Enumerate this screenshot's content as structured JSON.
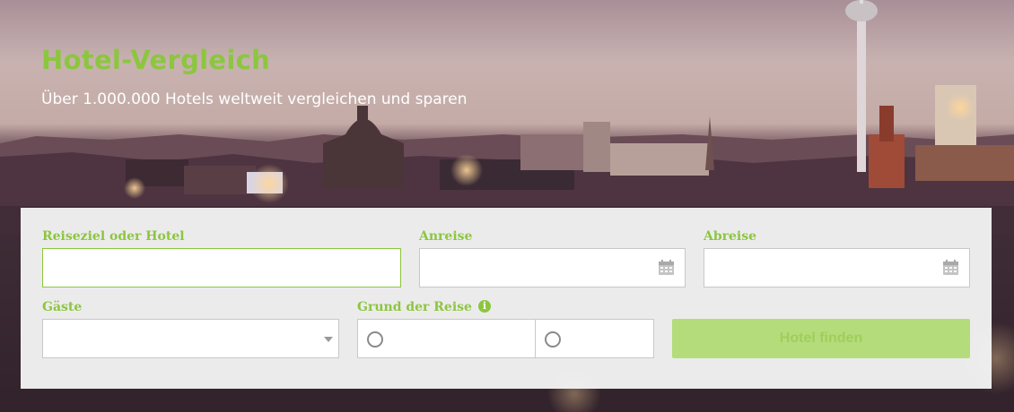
{
  "hero": {
    "title": "Hotel-Vergleich",
    "subtitle": "Über 1.000.000 Hotels weltweit vergleichen und sparen"
  },
  "form": {
    "destination_label": "Reiseziel oder Hotel",
    "destination_value": "",
    "checkin_label": "Anreise",
    "checkin_value": "",
    "checkout_label": "Abreise",
    "checkout_value": "",
    "guests_label": "Gäste",
    "guests_value": "",
    "reason_label": "Grund der Reise",
    "reason_options": [
      "",
      ""
    ],
    "submit_label": "Hotel finden"
  },
  "icons": {
    "calendar": "calendar-icon",
    "info": "info-icon",
    "dropdown": "chevron-down-icon"
  },
  "colors": {
    "accent": "#8cc63f",
    "button_bg": "#b5dc7a",
    "panel_bg": "#f4f4f4"
  }
}
